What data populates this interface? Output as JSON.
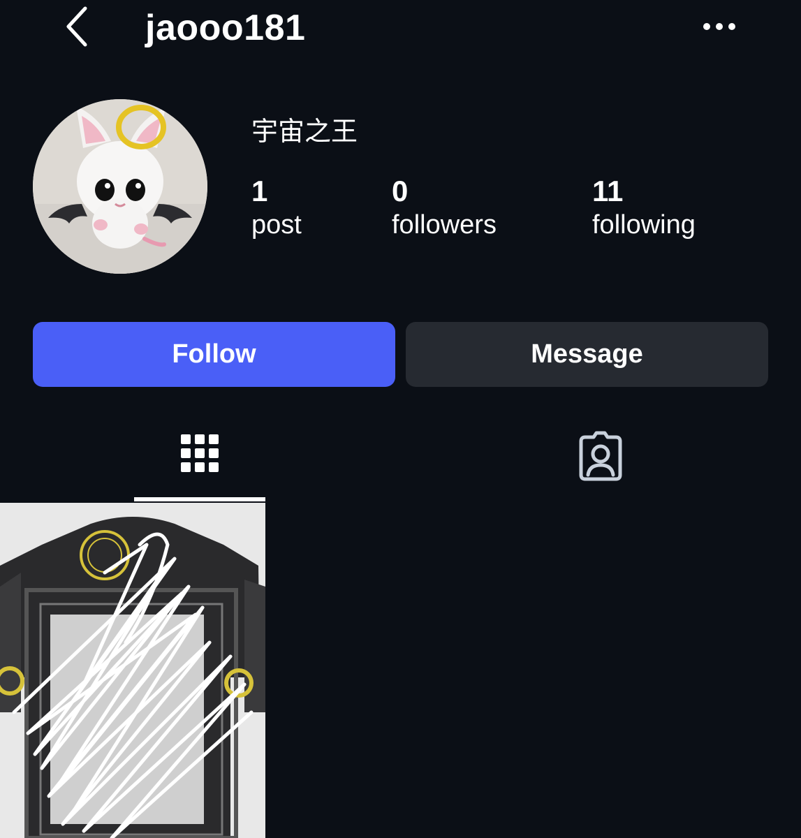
{
  "header": {
    "username": "jaooo181"
  },
  "profile": {
    "display_name": "宇宙之王",
    "stats": [
      {
        "count": "1",
        "label": "post"
      },
      {
        "count": "0",
        "label": "followers"
      },
      {
        "count": "11",
        "label": "following"
      }
    ]
  },
  "actions": {
    "follow_label": "Follow",
    "message_label": "Message"
  },
  "tabs": [
    {
      "icon": "grid-icon",
      "active": true
    },
    {
      "icon": "tagged-person-icon",
      "active": false
    }
  ],
  "colors": {
    "background": "#0b0f16",
    "follow_button": "#4a5ff7",
    "message_button": "#262a31",
    "text": "#ffffff",
    "tagged_icon": "#c9d1dc"
  }
}
